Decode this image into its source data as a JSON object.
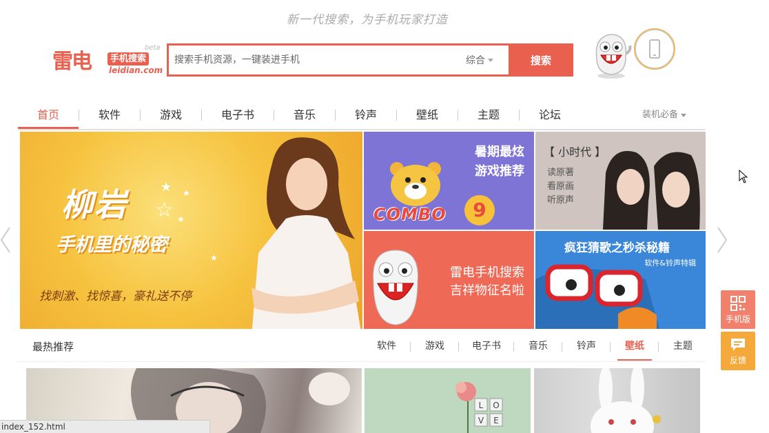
{
  "header": {
    "slogan": "新一代搜索，为手机玩家打造",
    "logo": {
      "main": "雷电",
      "tag": "手机搜索",
      "domain": "leidian.com",
      "beta": "beta"
    },
    "search": {
      "placeholder": "搜索手机资源，一键装进手机",
      "value": "",
      "category": "综合",
      "button": "搜索"
    }
  },
  "nav": {
    "items": [
      "首页",
      "软件",
      "游戏",
      "电子书",
      "音乐",
      "铃声",
      "壁纸",
      "主题",
      "论坛"
    ],
    "active_index": 0,
    "more": "装机必备"
  },
  "banners": {
    "main": {
      "title": "柳岩",
      "subtitle": "手机里的秘密",
      "tagline": "找刺激、找惊喜，豪礼送不停"
    },
    "game": {
      "line1": "暑期最炫",
      "line2": "游戏推荐",
      "combo": "COMBO",
      "number": "9"
    },
    "movie": {
      "title": "【 小时代 】",
      "lines": [
        "读原著",
        "看原画",
        "听原声"
      ]
    },
    "mascot": {
      "line1": "雷电手机搜索",
      "line2": "吉祥物征名啦"
    },
    "song": {
      "line1": "疯狂猜歌之秒杀秘籍",
      "line2": "软件&铃声特辑"
    }
  },
  "hot": {
    "title": "最热推荐",
    "tabs": [
      "软件",
      "游戏",
      "电子书",
      "音乐",
      "铃声",
      "壁纸",
      "主题"
    ],
    "active_tab": "壁纸"
  },
  "thumbs": {
    "love_letters": [
      "L",
      "O",
      "V",
      "E"
    ]
  },
  "float": {
    "mobile": "手机版",
    "feedback": "反馈"
  },
  "status_bar": "index_152.html",
  "colors": {
    "brand": "#e9604f",
    "feedback": "#f4a93a",
    "mobile": "#f1816d"
  }
}
